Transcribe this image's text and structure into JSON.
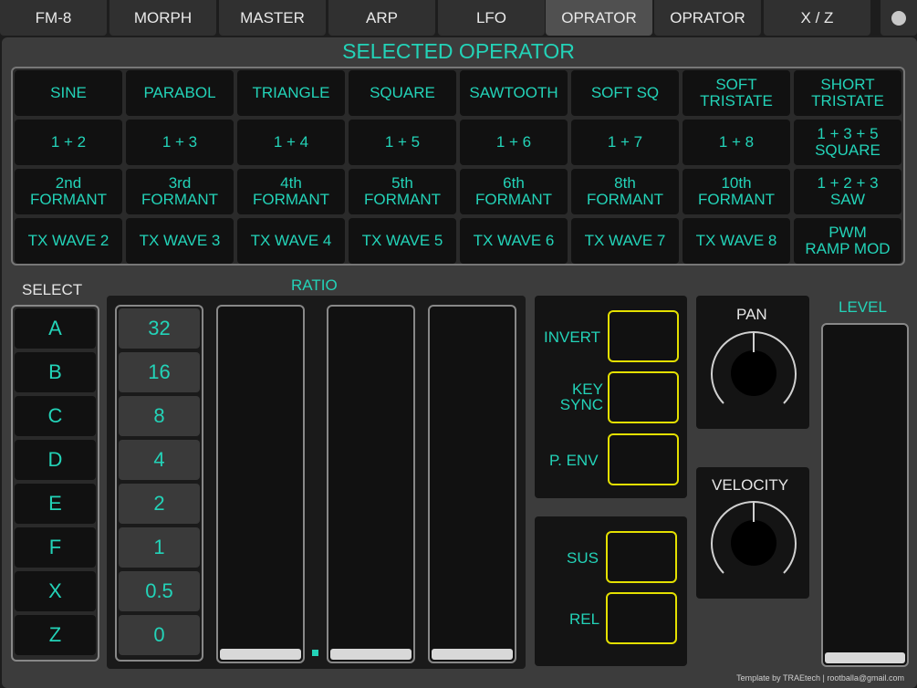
{
  "tabs": [
    {
      "label": "FM-8",
      "active": false
    },
    {
      "label": "MORPH",
      "active": false
    },
    {
      "label": "MASTER",
      "active": false
    },
    {
      "label": "ARP",
      "active": false
    },
    {
      "label": "LFO",
      "active": false
    },
    {
      "label": "OPRATOR",
      "active": true
    },
    {
      "label": "OPRATOR",
      "active": false
    },
    {
      "label": "X / Z",
      "active": false
    }
  ],
  "section_title": "SELECTED OPERATOR",
  "waveforms": [
    [
      "SINE",
      "PARABOL",
      "TRIANGLE",
      "SQUARE",
      "SAWTOOTH",
      "SOFT SQ",
      "SOFT\nTRISTATE",
      "SHORT\nTRISTATE"
    ],
    [
      "1 + 2",
      "1 + 3",
      "1 + 4",
      "1 + 5",
      "1 + 6",
      "1 + 7",
      "1 + 8",
      "1 + 3 + 5\nSQUARE"
    ],
    [
      "2nd\nFORMANT",
      "3rd\nFORMANT",
      "4th\nFORMANT",
      "5th\nFORMANT",
      "6th\nFORMANT",
      "8th\nFORMANT",
      "10th\nFORMANT",
      "1 + 2 + 3\nSAW"
    ],
    [
      "TX WAVE 2",
      "TX WAVE 3",
      "TX WAVE 4",
      "TX WAVE 5",
      "TX WAVE 6",
      "TX WAVE 7",
      "TX WAVE 8",
      "PWM\nRAMP MOD"
    ]
  ],
  "select": {
    "label": "SELECT",
    "items": [
      "A",
      "B",
      "C",
      "D",
      "E",
      "F",
      "X",
      "Z"
    ]
  },
  "ratio": {
    "label": "RATIO",
    "values": [
      "32",
      "16",
      "8",
      "4",
      "2",
      "1",
      "0.5",
      "0"
    ]
  },
  "toggles": {
    "invert": "INVERT",
    "key_sync": "KEY\nSYNC",
    "p_env": "P. ENV",
    "sus": "SUS",
    "rel": "REL"
  },
  "pan": {
    "label": "PAN"
  },
  "velocity": {
    "label": "VELOCITY"
  },
  "level": {
    "label": "LEVEL"
  },
  "footer": "Template by TRAEtech | rootballa@gmail.com",
  "colors": {
    "accent": "#23d3b8",
    "toggle_border": "#e4e000"
  }
}
